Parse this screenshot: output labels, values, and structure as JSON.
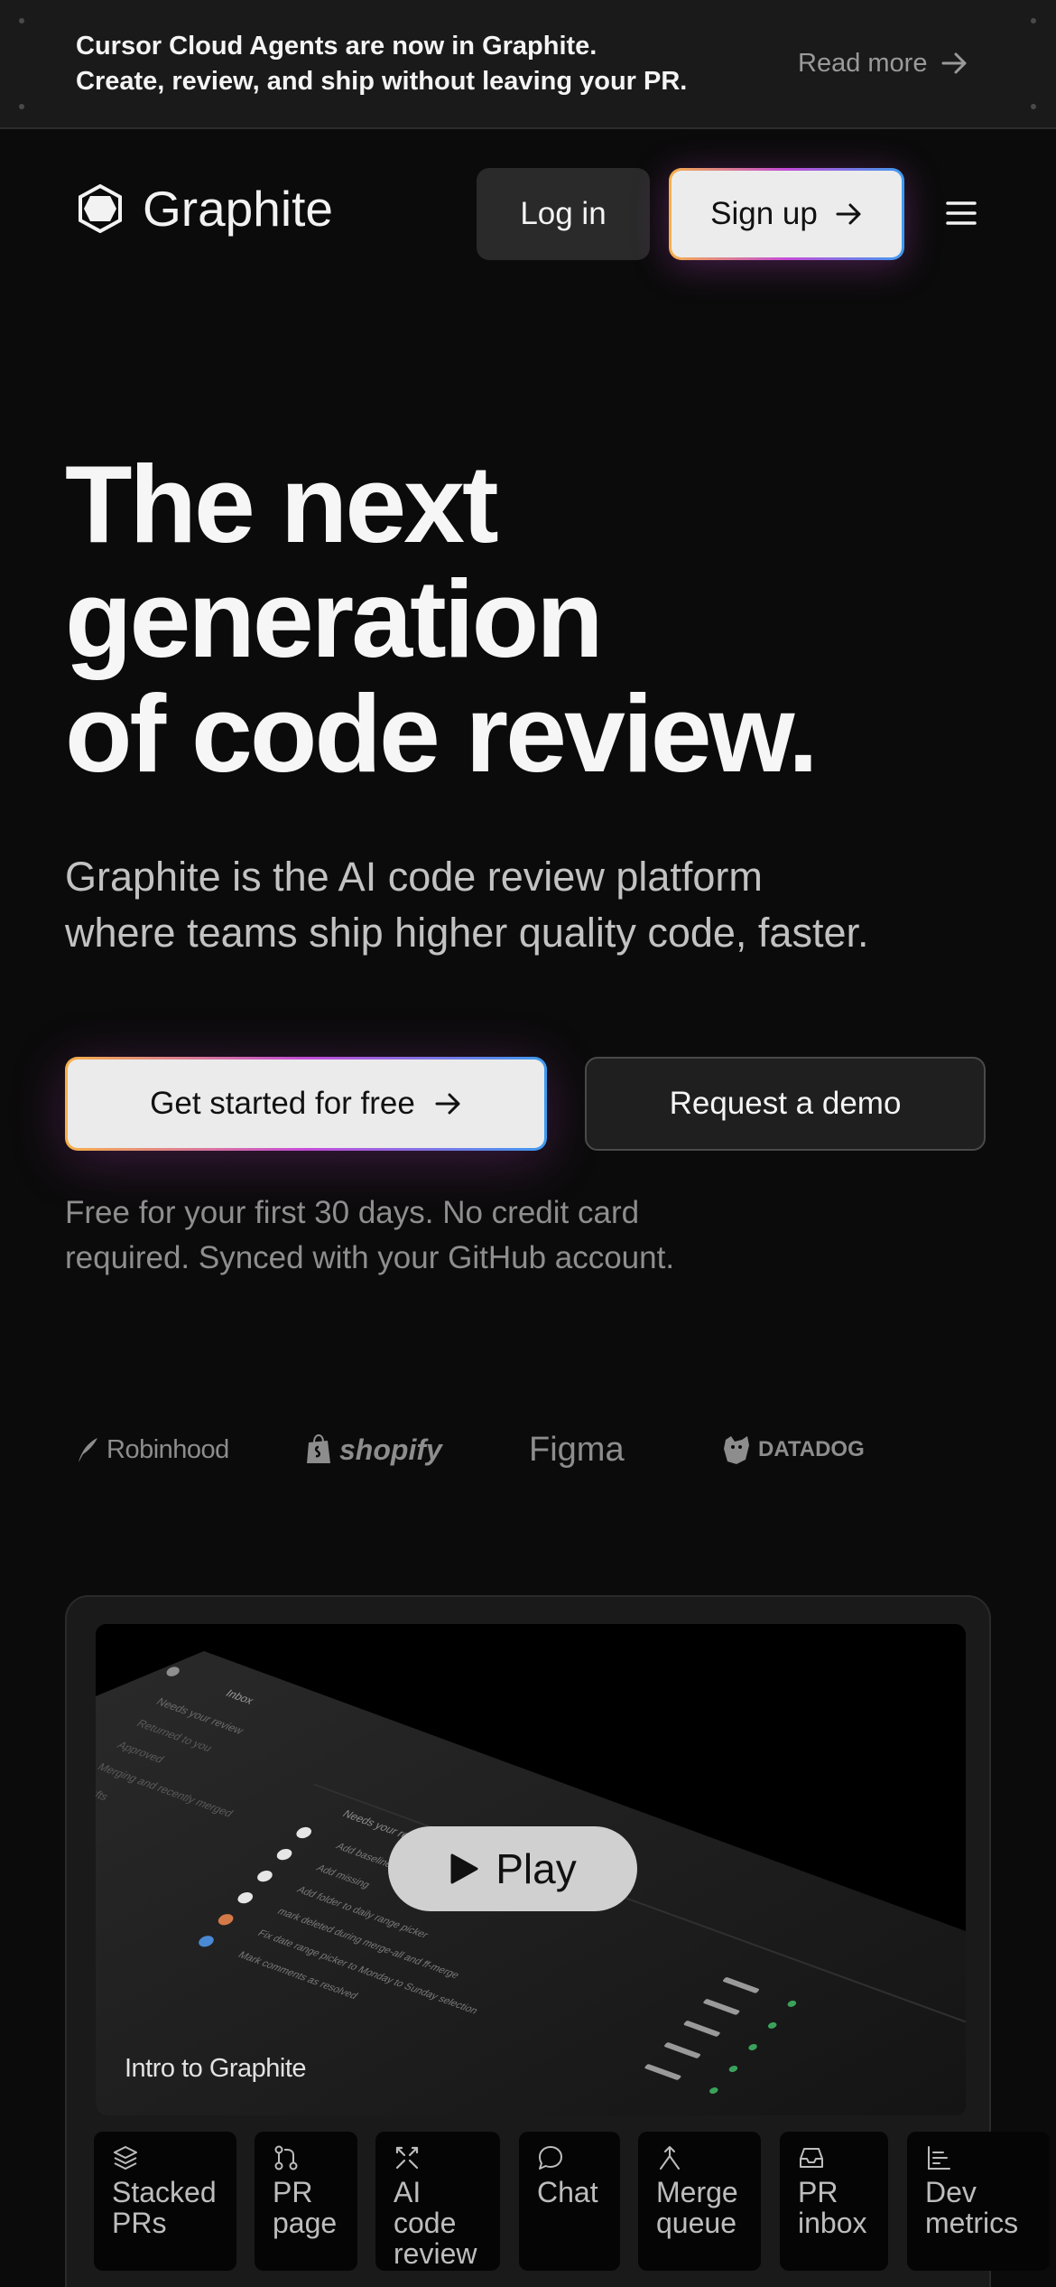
{
  "banner": {
    "line1": "Cursor Cloud Agents are now in Graphite.",
    "line2": "Create, review, and ship without leaving your PR.",
    "read_more": "Read more"
  },
  "header": {
    "brand": "Graphite",
    "login": "Log in",
    "signup": "Sign up"
  },
  "hero": {
    "title_lines": [
      "The next",
      "generation",
      "of code review."
    ],
    "subtitle_lines": [
      "Graphite is the AI code review platform",
      "where teams ship higher quality code, faster."
    ],
    "cta_primary": "Get started for free",
    "cta_secondary": "Request a demo",
    "note_lines": [
      "Free for your first 30 days. No credit card",
      "required. Synced with your GitHub account."
    ]
  },
  "customers": [
    "Robinhood",
    "shopify",
    "Figma",
    "DATADOG"
  ],
  "video": {
    "play": "Play",
    "caption": "Intro to Graphite",
    "mock": {
      "inbox": "Inbox",
      "sidebar": [
        "Needs your review",
        "Returned to you",
        "Approved",
        "Merging and recently merged",
        "Drafts"
      ],
      "section": "Needs your review",
      "rows": [
        "Add baseline",
        "Add missing",
        "Add folder to daily range picker",
        "mark deleted during merge-all and ff-merge",
        "Fix date range picker to Monday to Sunday selection",
        "Mark comments as resolved"
      ]
    }
  },
  "features": [
    {
      "label": "Stacked\nPRs",
      "icon": "stack-icon"
    },
    {
      "label": "PR\npage",
      "icon": "pull-request-icon"
    },
    {
      "label": "AI\ncode\nreview",
      "icon": "ai-review-icon"
    },
    {
      "label": "Chat",
      "icon": "chat-icon"
    },
    {
      "label": "Merge\nqueue",
      "icon": "merge-icon"
    },
    {
      "label": "PR\ninbox",
      "icon": "inbox-icon"
    },
    {
      "label": "Dev\nmetrics",
      "icon": "metrics-icon"
    }
  ],
  "colors": {
    "background": "#0b0b0b",
    "banner": "#1a1a1a",
    "primary_button": "#ebebeb",
    "gradient_start": "#f6b04a",
    "gradient_mid": "#c44bd8",
    "gradient_end": "#3d9bf0"
  }
}
